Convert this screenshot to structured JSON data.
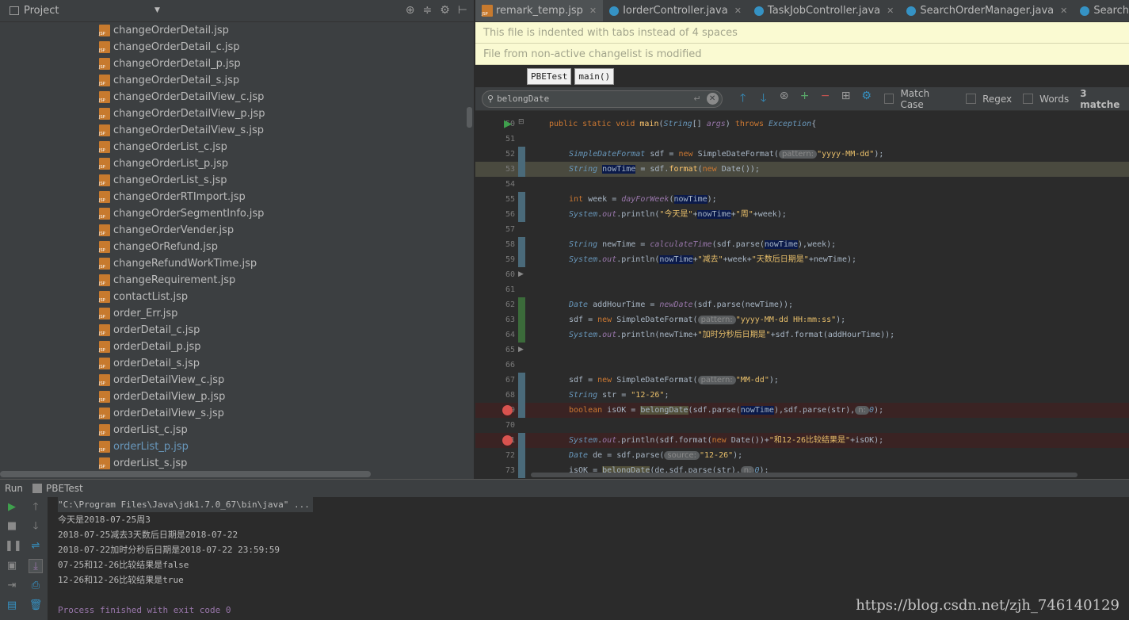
{
  "project": {
    "title": "Project",
    "files": [
      {
        "name": "changeOrderDetail.jsp"
      },
      {
        "name": "changeOrderDetail_c.jsp"
      },
      {
        "name": "changeOrderDetail_p.jsp"
      },
      {
        "name": "changeOrderDetail_s.jsp"
      },
      {
        "name": "changeOrderDetailView_c.jsp"
      },
      {
        "name": "changeOrderDetailView_p.jsp"
      },
      {
        "name": "changeOrderDetailView_s.jsp"
      },
      {
        "name": "changeOrderList_c.jsp"
      },
      {
        "name": "changeOrderList_p.jsp"
      },
      {
        "name": "changeOrderList_s.jsp"
      },
      {
        "name": "changeOrderRTImport.jsp"
      },
      {
        "name": "changeOrderSegmentInfo.jsp"
      },
      {
        "name": "changeOrderVender.jsp"
      },
      {
        "name": "changeOrRefund.jsp"
      },
      {
        "name": "changeRefundWorkTime.jsp"
      },
      {
        "name": "changeRequirement.jsp"
      },
      {
        "name": "contactList.jsp"
      },
      {
        "name": "order_Err.jsp"
      },
      {
        "name": "orderDetail_c.jsp"
      },
      {
        "name": "orderDetail_p.jsp"
      },
      {
        "name": "orderDetail_s.jsp"
      },
      {
        "name": "orderDetailView_c.jsp"
      },
      {
        "name": "orderDetailView_p.jsp"
      },
      {
        "name": "orderDetailView_s.jsp"
      },
      {
        "name": "orderList_c.jsp"
      },
      {
        "name": "orderList_p.jsp"
      },
      {
        "name": "orderList_s.jsp"
      }
    ]
  },
  "tabs": [
    {
      "label": "remark_temp.jsp"
    },
    {
      "label": "IorderController.java"
    },
    {
      "label": "TaskJobController.java"
    },
    {
      "label": "SearchOrderManager.java"
    },
    {
      "label": "SearchOrderDao"
    }
  ],
  "notifications": {
    "tabs_notice": "This file is indented with tabs instead of 4 spaces",
    "changelist_notice": "File from non-active changelist is modified"
  },
  "breadcrumb": {
    "class": "PBETest",
    "method": "main()"
  },
  "search": {
    "query": "belongDate",
    "match_case": "Match Case",
    "regex": "Regex",
    "words": "Words",
    "match_count": "3 matche"
  },
  "line_numbers": [
    "50",
    "51",
    "52",
    "53",
    "54",
    "55",
    "56",
    "57",
    "58",
    "59",
    "60",
    "61",
    "62",
    "63",
    "64",
    "65",
    "66",
    "67",
    "68",
    "69",
    "70",
    "71",
    "72",
    "73"
  ],
  "code": {
    "l50_kw": "public static void ",
    "l50_fn": "main",
    "l50_a": "(",
    "l50_t": "String",
    "l50_b": "[] ",
    "l50_p": "args",
    "l50_c": ") ",
    "l50_kw2": "throws ",
    "l50_t2": "Exception",
    "l50_d": "{",
    "l52_t": "SimpleDateFormat",
    "l52_a": " sdf = ",
    "l52_kw": "new ",
    "l52_b": "SimpleDateFormat(",
    "l52_h": "pattern:",
    "l52_s": "\"yyyy-MM-dd\"",
    "l52_c": ");",
    "l53_t": "String",
    "l53_v": "nowTime",
    "l53_a": " = sdf.",
    "l53_fn": "format",
    "l53_b": "(",
    "l53_kw": "new ",
    "l53_c": "Date());",
    "l55_kw": "int ",
    "l55_a": "week = ",
    "l55_fn": "dayForWeek",
    "l55_b": "(",
    "l55_v": "nowTime",
    "l55_c": ");",
    "l56_t": "System",
    "l56_d": ".",
    "l56_f": "out",
    "l56_a": ".println(",
    "l56_s1": "\"今天是\"",
    "l56_p1": "+",
    "l56_v": "nowTime",
    "l56_p2": "+",
    "l56_s2": "\"周\"",
    "l56_b": "+week);",
    "l58_t": "String",
    "l58_a": " newTime = ",
    "l58_fn": "calculateTime",
    "l58_b": "(sdf.parse(",
    "l58_v": "nowTime",
    "l58_c": "),week);",
    "l59_t": "System",
    "l59_d": ".",
    "l59_f": "out",
    "l59_a": ".println(",
    "l59_v": "nowTime",
    "l59_p1": "+",
    "l59_s1": "\"减去\"",
    "l59_b": "+week+",
    "l59_s2": "\"天数后日期是\"",
    "l59_c": "+newTime);",
    "l62_t": "Date",
    "l62_a": " addHourTime = ",
    "l62_fn": "newDate",
    "l62_b": "(sdf.parse(newTime));",
    "l63_a": "sdf = ",
    "l63_kw": "new ",
    "l63_b": "SimpleDateFormat(",
    "l63_h": "pattern:",
    "l63_s": "\"yyyy-MM-dd HH:mm:ss\"",
    "l63_c": ");",
    "l64_t": "System",
    "l64_d": ".",
    "l64_f": "out",
    "l64_a": ".println(newTime+",
    "l64_s": "\"加时分秒后日期是\"",
    "l64_b": "+sdf.format(addHourTime));",
    "l67_a": "sdf = ",
    "l67_kw": "new ",
    "l67_b": "SimpleDateFormat(",
    "l67_h": "pattern:",
    "l67_s": "\"MM-dd\"",
    "l67_c": ");",
    "l68_t": "String",
    "l68_a": " str = ",
    "l68_s": "\"12-26\"",
    "l68_b": ";",
    "l69_kw": "boolean ",
    "l69_a": "isOK = ",
    "l69_m": "belongDate",
    "l69_b": "(sdf.parse(",
    "l69_v": "nowTime",
    "l69_c": "),sdf.parse(str),",
    "l69_h": "n:",
    "l69_n": "0",
    "l69_d": ");",
    "l71_t": "System",
    "l71_d": ".",
    "l71_f": "out",
    "l71_a": ".println(sdf.format(",
    "l71_kw": "new ",
    "l71_b": "Date())+",
    "l71_s": "\"和12-26比较结果是\"",
    "l71_c": "+isOK);",
    "l72_t": "Date",
    "l72_a": " de = sdf.parse(",
    "l72_h": "source:",
    "l72_s": "\"12-26\"",
    "l72_b": ");",
    "l73_a": "isOK = ",
    "l73_m": "belongDate",
    "l73_b": "(de,sdf.parse(str),",
    "l73_h": "n:",
    "l73_n": "0",
    "l73_c": ");"
  },
  "run": {
    "label": "Run",
    "config": "PBETest",
    "console": [
      "\"C:\\Program Files\\Java\\jdk1.7.0_67\\bin\\java\" ...",
      "今天是2018-07-25周3",
      "2018-07-25减去3天数后日期是2018-07-22",
      "2018-07-22加时分秒后日期是2018-07-22 23:59:59",
      "07-25和12-26比较结果是false",
      "12-26和12-26比较结果是true",
      "",
      "Process finished with exit code 0"
    ]
  },
  "watermark": "https://blog.csdn.net/zjh_746140129"
}
